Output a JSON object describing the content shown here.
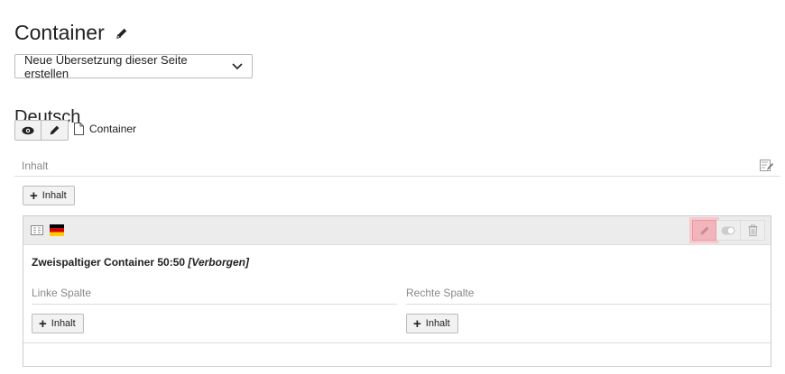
{
  "page": {
    "title": "Container"
  },
  "translation_select": {
    "value": "Neue Übersetzung dieser Seite erstellen"
  },
  "language": {
    "heading": "Deutsch"
  },
  "page_ref": {
    "label": "Container"
  },
  "column": {
    "label": "Inhalt",
    "add_label": "Inhalt"
  },
  "element": {
    "title": "Zweispaltiger Container 50:50",
    "status": "[Verborgen]",
    "left_column": {
      "label": "Linke Spalte",
      "add_label": "Inhalt"
    },
    "right_column": {
      "label": "Rechte Spalte",
      "add_label": "Inhalt"
    }
  },
  "colors": {
    "highlight": "#f3b5bc",
    "button_bg": "#f2f2f2",
    "header_bg": "#ececec"
  },
  "icons": [
    "pencil-icon",
    "chevron-down-icon",
    "eye-icon",
    "document-icon",
    "column-edit-icon",
    "content-type-icon",
    "german-flag-icon",
    "toggle-icon",
    "trash-icon"
  ]
}
